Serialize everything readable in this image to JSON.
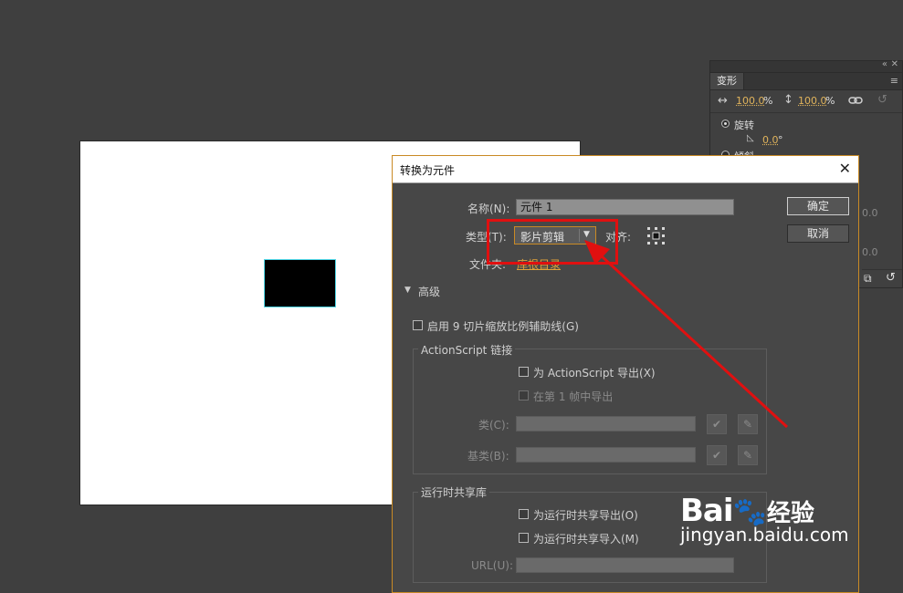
{
  "transform_panel": {
    "tab": "变形",
    "width": "100.0",
    "height": "100.0",
    "percent": "%",
    "rotate_label": "旋转",
    "rotate_value": "0.0",
    "degree": "°",
    "skew_label": "倾斜",
    "side_values": [
      "0.0",
      "0.0"
    ]
  },
  "dialog": {
    "title": "转换为元件",
    "name_label": "名称(N):",
    "name_value": "元件 1",
    "type_label": "类型(T):",
    "type_value": "影片剪辑",
    "align_label": "对齐:",
    "folder_label": "文件夹:",
    "folder_value": "库根目录",
    "ok": "确定",
    "cancel": "取消",
    "advanced": "高级",
    "enable_9slice": "启用 9 切片缩放比例辅助线(G)",
    "actionscript_group": "ActionScript 链接",
    "export_as": "为 ActionScript 导出(X)",
    "export_frame1": "在第 1 帧中导出",
    "class_label": "类(C):",
    "base_class_label": "基类(B):",
    "runtime_group": "运行时共享库",
    "export_runtime": "为运行时共享导出(O)",
    "import_runtime": "为运行时共享导入(M)",
    "url_label": "URL(U):"
  },
  "watermark": {
    "brand": "Bai",
    "brand_suffix": "经验",
    "url": "jingyan.baidu.com"
  },
  "colors": {
    "accent_orange": "#c98a25",
    "annotation_red": "#e01010",
    "value_gold": "#e0b35b"
  }
}
